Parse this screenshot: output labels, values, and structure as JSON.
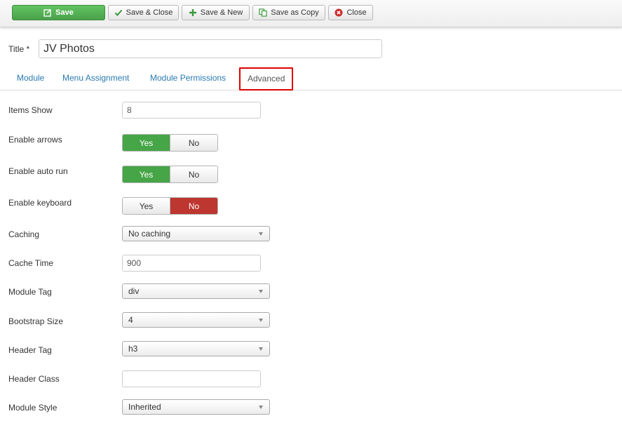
{
  "toolbar": {
    "save": {
      "label": "Save",
      "icon": "edit-icon"
    },
    "save_close": {
      "label": "Save & Close",
      "icon": "check-icon"
    },
    "save_new": {
      "label": "Save & New",
      "icon": "plus-icon"
    },
    "save_copy": {
      "label": "Save as Copy",
      "icon": "copy-icon"
    },
    "close": {
      "label": "Close",
      "icon": "cancel-circle-icon"
    }
  },
  "title": {
    "label": "Title *",
    "value": "JV Photos"
  },
  "tabs": [
    {
      "label": "Module"
    },
    {
      "label": "Menu Assignment"
    },
    {
      "label": "Module Permissions"
    },
    {
      "label": "Advanced",
      "active": true
    }
  ],
  "fields": {
    "items_show": {
      "label": "Items Show",
      "value": "8"
    },
    "enable_arrows": {
      "label": "Enable arrows",
      "yes": "Yes",
      "no": "No",
      "selected": "Yes"
    },
    "enable_auto_run": {
      "label": "Enable auto run",
      "yes": "Yes",
      "no": "No",
      "selected": "Yes"
    },
    "enable_keyboard": {
      "label": "Enable keyboard",
      "yes": "Yes",
      "no": "No",
      "selected": "No"
    },
    "caching": {
      "label": "Caching",
      "value": "No caching"
    },
    "cache_time": {
      "label": "Cache Time",
      "value": "900"
    },
    "module_tag": {
      "label": "Module Tag",
      "value": "div"
    },
    "bootstrap_size": {
      "label": "Bootstrap Size",
      "value": "4"
    },
    "header_tag": {
      "label": "Header Tag",
      "value": "h3"
    },
    "header_class": {
      "label": "Header Class",
      "value": ""
    },
    "module_style": {
      "label": "Module Style",
      "value": "Inherited"
    }
  },
  "colors": {
    "save_green": "#4aa04a",
    "yes_green": "#46a546",
    "no_red": "#bd362f",
    "link_blue": "#2a7ab0",
    "active_tab_outline": "#e00000"
  }
}
